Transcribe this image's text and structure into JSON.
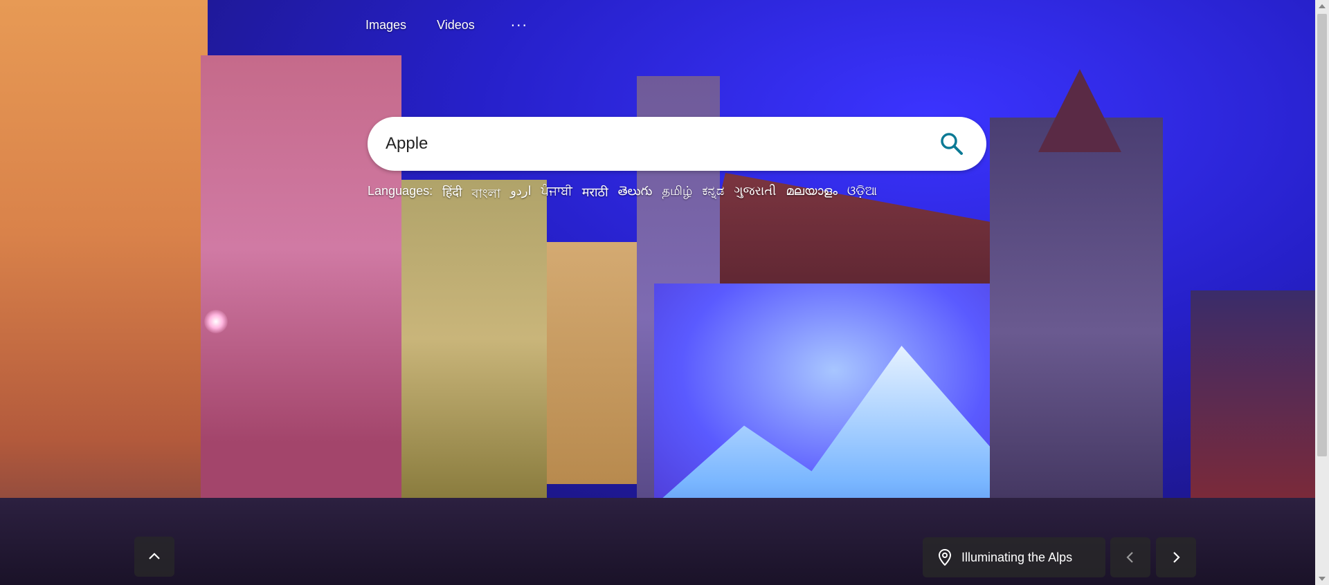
{
  "nav": {
    "images": "Images",
    "videos": "Videos",
    "more": "···"
  },
  "search": {
    "value": "Apple"
  },
  "languages": {
    "label": "Languages:",
    "items": [
      "हिंदी",
      "বাংলা",
      "اردو",
      "ਪੰਜਾਬੀ",
      "मराठी",
      "తెలుగు",
      "தமிழ்",
      "ಕನ್ನಡ",
      "ગુજરાતી",
      "മലയാളം",
      "ଓଡ଼ିଆ"
    ]
  },
  "image_caption": {
    "title": "Illuminating the Alps"
  },
  "icons": {
    "search": "search-icon",
    "up": "chevron-up-icon",
    "pin": "location-pin-icon",
    "prev": "chevron-left-icon",
    "next": "chevron-right-icon"
  },
  "colors": {
    "search_icon": "#0c7a95"
  }
}
